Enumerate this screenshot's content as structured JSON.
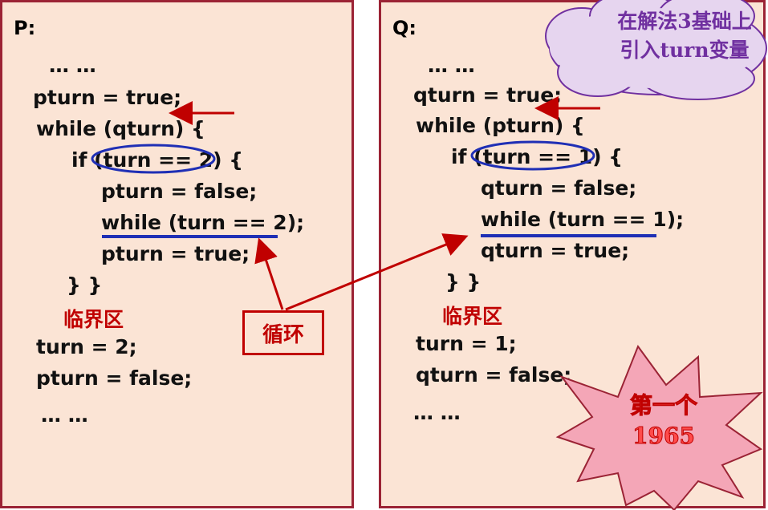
{
  "left_panel": {
    "label": "P:",
    "lines": [
      "… …",
      "pturn = true;",
      "while (qturn) {",
      "if (turn == 2) {",
      "pturn = false;",
      "while (turn == 2);",
      "pturn = true;",
      "} }",
      "turn = 2;",
      "pturn = false;",
      "… …"
    ],
    "critical": "临界区"
  },
  "right_panel": {
    "label": "Q:",
    "lines": [
      "… …",
      "qturn = true;",
      "while (pturn) {",
      "if (turn == 1) {",
      "qturn = false;",
      "while (turn == 1);",
      "qturn = true;",
      "} }",
      "turn = 1;",
      "qturn = false;",
      "… …"
    ],
    "critical": "临界区"
  },
  "cloud": {
    "line1": "在解法3基础上",
    "line2": "引入turn变量"
  },
  "loop_label": "循环",
  "star": {
    "line1": "第一个",
    "line2": "1965"
  },
  "colors": {
    "panel_bg": "#fbe4d5",
    "panel_border": "#9b2335",
    "arrow": "#c00000",
    "ellipse": "#1f2fb5",
    "cloud": "#e6d5ef",
    "cloud_text": "#7030a0",
    "star_fill": "#f4a6b7"
  }
}
